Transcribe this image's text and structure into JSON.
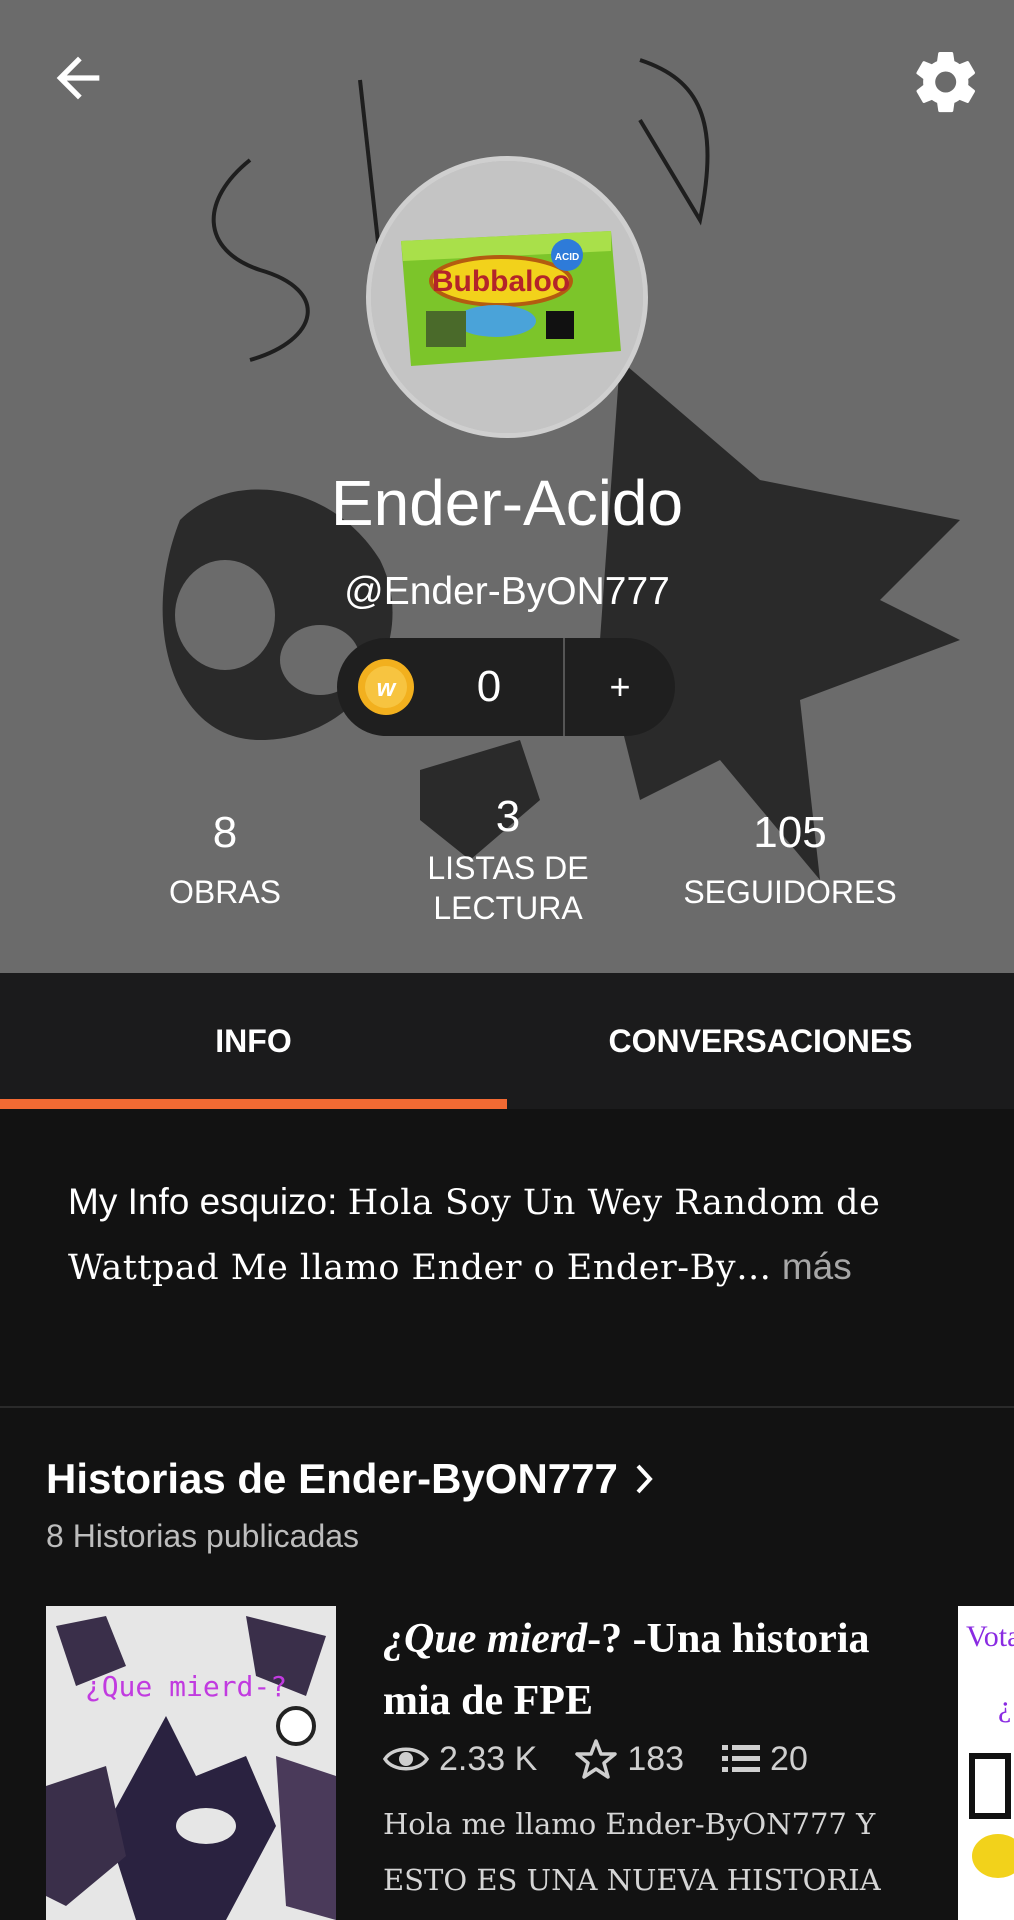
{
  "profile": {
    "display_name": "Ender-Acido",
    "username": "@Ender-ByON777",
    "coins": "0",
    "coin_add": "+"
  },
  "stats": [
    {
      "value": "8",
      "label": "OBRAS"
    },
    {
      "value": "3",
      "label": "LISTAS DE LECTURA"
    },
    {
      "value": "105",
      "label": "SEGUIDORES"
    }
  ],
  "tabs": [
    {
      "label": "INFO",
      "active": true
    },
    {
      "label": "CONVERSACIONES",
      "active": false
    }
  ],
  "info": {
    "prefix": "My Info esquizo: ",
    "text": "Hola Soy Un Wey Random de Wattpad Me llamo Ender o Ender-By…",
    "more": " más"
  },
  "stories": {
    "title": "Historias de Ender-ByON777",
    "subtitle": "8 Historias publicadas",
    "items": [
      {
        "title_italic": "¿Que mierd",
        "title_rest": "-?   -Una historia mia de FPE",
        "cover_text": "¿Que mierd-?",
        "views": "2.33 K",
        "votes": "183",
        "parts": "20",
        "description": "Hola me llamo Ender-ByON777 Y ESTO ES UNA NUEVA HISTORIA"
      }
    ],
    "next_cover_text": "Vota"
  },
  "avatar": {
    "product_text": "Bubbaloo",
    "product_badge": "ACID"
  },
  "colors": {
    "header_bg": "#6b6b6b",
    "accent": "#f26a33",
    "tabs_bg": "#1b1b1c",
    "page_bg": "#121212",
    "coin": "#f2b01e"
  }
}
